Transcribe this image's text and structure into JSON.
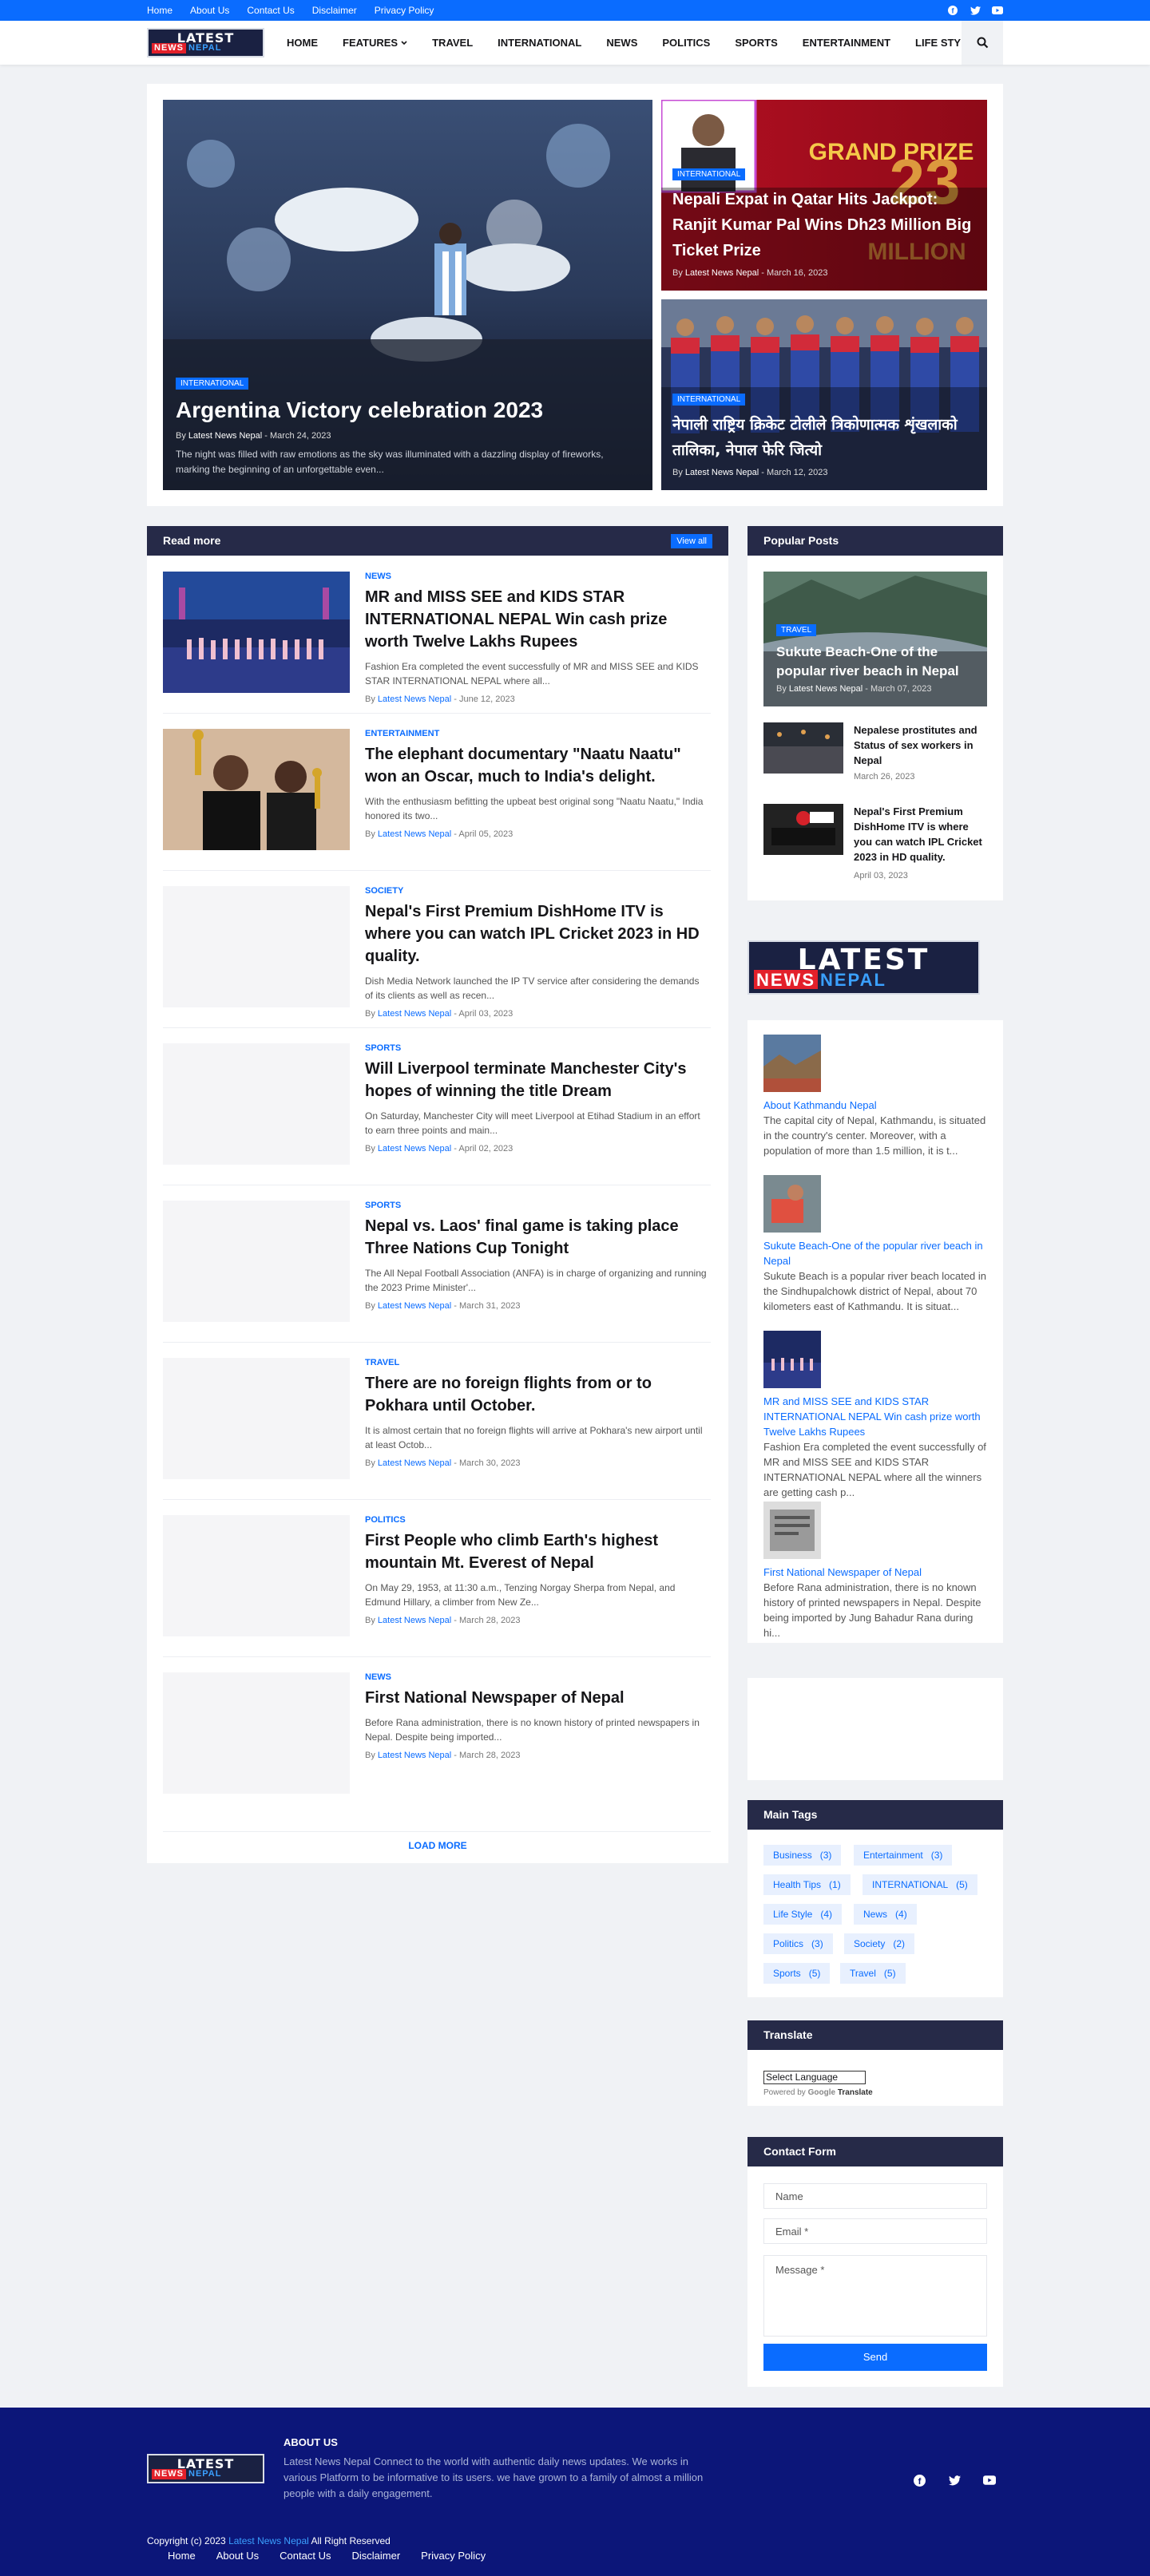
{
  "topbar": {
    "links": [
      "Home",
      "About Us",
      "Contact Us",
      "Disclaimer",
      "Privacy Policy"
    ],
    "social_icons": [
      "facebook-icon",
      "twitter-icon",
      "youtube-icon"
    ]
  },
  "logo": {
    "line1": "LATEST",
    "line2a": "NEWS",
    "line2b": "NEPAL"
  },
  "nav": {
    "items": [
      "HOME",
      "FEATURES",
      "TRAVEL",
      "INTERNATIONAL",
      "NEWS",
      "POLITICS",
      "SPORTS",
      "ENTERTAINMENT",
      "LIFE STYLE"
    ],
    "search_icon": "search-icon"
  },
  "hero": {
    "main": {
      "tag": "INTERNATIONAL",
      "title": "Argentina Victory celebration 2023",
      "snippet": "The night was filled with raw emotions as the sky was illuminated with a dazzling display of fireworks, marking the beginning of an unforgettable even...",
      "author": "Latest News Nepal",
      "date": "March 24, 2023"
    },
    "side": [
      {
        "tag": "INTERNATIONAL",
        "title": "Nepali Expat in Qatar Hits Jackpot: Ranjit Kumar Pal Wins Dh23 Million Big Ticket Prize",
        "author": "Latest News Nepal",
        "date": "March 16, 2023",
        "image_text1": "GRAND PRIZE",
        "image_text2": "MILLION"
      },
      {
        "tag": "INTERNATIONAL",
        "title": "नेपाली राष्ट्रिय क्रिकेट टोलीले त्रिकोणात्मक शृंखलाको तालिका, नेपाल फेरि जित्यो",
        "author": "Latest News Nepal",
        "date": "March 12, 2023"
      }
    ]
  },
  "readmore": {
    "heading": "Read more",
    "view_all": "View all",
    "load_more": "LOAD MORE",
    "by": "By",
    "articles": [
      {
        "category": "NEWS",
        "title": "MR and MISS SEE and KIDS STAR INTERNATIONAL NEPAL Win cash prize worth Twelve Lakhs Rupees",
        "snippet": "Fashion Era completed the event successfully of MR and MISS SEE and KIDS STAR INTERNATIONAL NEPAL where all...",
        "author": "Latest News Nepal",
        "date": "June 12, 2023"
      },
      {
        "category": "ENTERTAINMENT",
        "title": "The elephant documentary \"Naatu Naatu\" won an Oscar, much to India's delight.",
        "snippet": "With the enthusiasm befitting the upbeat best original song \"Naatu Naatu,\" India honored its two...",
        "author": "Latest News Nepal",
        "date": "April 05, 2023"
      },
      {
        "category": "SOCIETY",
        "title": "Nepal's First Premium DishHome ITV is where you can watch IPL Cricket 2023 in HD quality.",
        "snippet": "Dish Media Network launched the IP TV service after considering the demands of its clients as well as recen...",
        "author": "Latest News Nepal",
        "date": "April 03, 2023"
      },
      {
        "category": "SPORTS",
        "title": "Will Liverpool terminate Manchester City's hopes of winning the title Dream",
        "snippet": "On Saturday, Manchester City will meet Liverpool at Etihad Stadium in an effort to earn three points and main...",
        "author": "Latest News Nepal",
        "date": "April 02, 2023"
      },
      {
        "category": "SPORTS",
        "title": "Nepal vs. Laos' final game is taking place Three Nations Cup Tonight",
        "snippet": "The All Nepal Football Association (ANFA) is in charge of organizing and running the 2023 Prime Minister'...",
        "author": "Latest News Nepal",
        "date": "March 31, 2023"
      },
      {
        "category": "TRAVEL",
        "title": "There are no foreign flights from or to Pokhara until October.",
        "snippet": "It is almost certain that no foreign flights will arrive at Pokhara's new airport until at least Octob...",
        "author": "Latest News Nepal",
        "date": "March 30, 2023"
      },
      {
        "category": "POLITICS",
        "title": "First People who climb Earth's highest mountain Mt. Everest of Nepal",
        "snippet": "On May 29, 1953, at 11:30 a.m., Tenzing Norgay Sherpa from Nepal, and Edmund Hillary, a climber from New Ze...",
        "author": "Latest News Nepal",
        "date": "March 28, 2023"
      },
      {
        "category": "NEWS",
        "title": "First National Newspaper of Nepal",
        "snippet": "Before Rana administration, there is no known history of printed newspapers in Nepal. Despite being imported...",
        "author": "Latest News Nepal",
        "date": "March 28, 2023"
      }
    ]
  },
  "popular": {
    "heading": "Popular Posts",
    "feature": {
      "tag": "TRAVEL",
      "title": "Sukute Beach-One of the popular river beach in Nepal",
      "author": "Latest News Nepal",
      "date": "March 07, 2023"
    },
    "items": [
      {
        "title": "Nepalese prostitutes and Status of sex workers in Nepal",
        "date": "March 26, 2023"
      },
      {
        "title": "Nepal's First Premium DishHome ITV is where you can watch IPL Cricket 2023 in HD quality.",
        "date": "April 03, 2023"
      }
    ]
  },
  "featured_list": [
    {
      "title": "About Kathmandu Nepal",
      "snippet": "The capital city of Nepal, Kathmandu, is situated in the country's center. Moreover, with a population of more than 1.5 million, it is t..."
    },
    {
      "title": "Sukute Beach-One of the popular river beach in Nepal",
      "snippet": " Sukute Beach is a popular river beach located in the Sindhupalchowk district of Nepal, about 70 kilometers east of Kathmandu. It is situat..."
    },
    {
      "title": "MR and MISS SEE and KIDS STAR INTERNATIONAL NEPAL Win cash prize worth Twelve Lakhs Rupees",
      "snippet": "Fashion Era completed the event successfully of MR and MISS SEE and KIDS STAR INTERNATIONAL NEPAL where all the winners are getting cash p..."
    },
    {
      "title": "First National Newspaper of Nepal",
      "snippet": " Before Rana administration, there is no known history of printed newspapers in Nepal. Despite being imported by Jung Bahadur Rana during hi..."
    }
  ],
  "tags": {
    "heading": "Main Tags",
    "items": [
      {
        "name": "Business",
        "count": "(3)"
      },
      {
        "name": "Entertainment",
        "count": "(3)"
      },
      {
        "name": "Health Tips",
        "count": "(1)"
      },
      {
        "name": "INTERNATIONAL",
        "count": "(5)"
      },
      {
        "name": "Life Style",
        "count": "(4)"
      },
      {
        "name": "News",
        "count": "(4)"
      },
      {
        "name": "Politics",
        "count": "(3)"
      },
      {
        "name": "Society",
        "count": "(2)"
      },
      {
        "name": "Sports",
        "count": "(5)"
      },
      {
        "name": "Travel",
        "count": "(5)"
      }
    ]
  },
  "translate": {
    "heading": "Translate",
    "select": "Select Language",
    "powered": "Powered by",
    "google": "Google",
    "translate_word": "Translate"
  },
  "contact": {
    "heading": "Contact Form",
    "name": "Name",
    "email": "Email *",
    "message": "Message *",
    "send": "Send"
  },
  "footer": {
    "about_heading": "ABOUT US",
    "about_text": "Latest News Nepal Connect to the world with authentic daily news updates. We works in various Platform to be informative to its users. we have grown to a family of almost a million people with a daily engagement.",
    "copyright_prefix": "Copyright (c) 2023",
    "copyright_brand": "Latest News Nepal",
    "copyright_suffix": "All Right Reserved",
    "links": [
      "Home",
      "About Us",
      "Contact Us",
      "Disclaimer",
      "Privacy Policy"
    ]
  },
  "colors": {
    "accent": "#0a6cff",
    "dark": "#262a48",
    "footer": "#0c1679"
  }
}
